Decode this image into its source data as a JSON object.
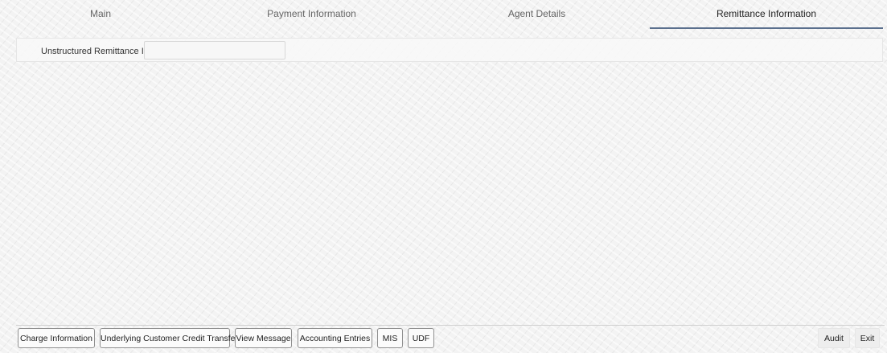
{
  "tabs": {
    "main": "Main",
    "payment_information": "Payment Information",
    "agent_details": "Agent Details",
    "remittance_information": "Remittance Information",
    "active": "remittance_information"
  },
  "remittance": {
    "unstructured_label": "Unstructured Remittance Info",
    "unstructured_value": ""
  },
  "footer": {
    "buttons": {
      "charge_information": "Charge Information",
      "underlying_customer_credit_transfer": "Underlying Customer Credit Transfer",
      "view_message": "View Message",
      "accounting_entries": "Accounting Entries",
      "mis": "MIS",
      "udf": "UDF"
    },
    "audit": "Audit",
    "exit": "Exit"
  }
}
